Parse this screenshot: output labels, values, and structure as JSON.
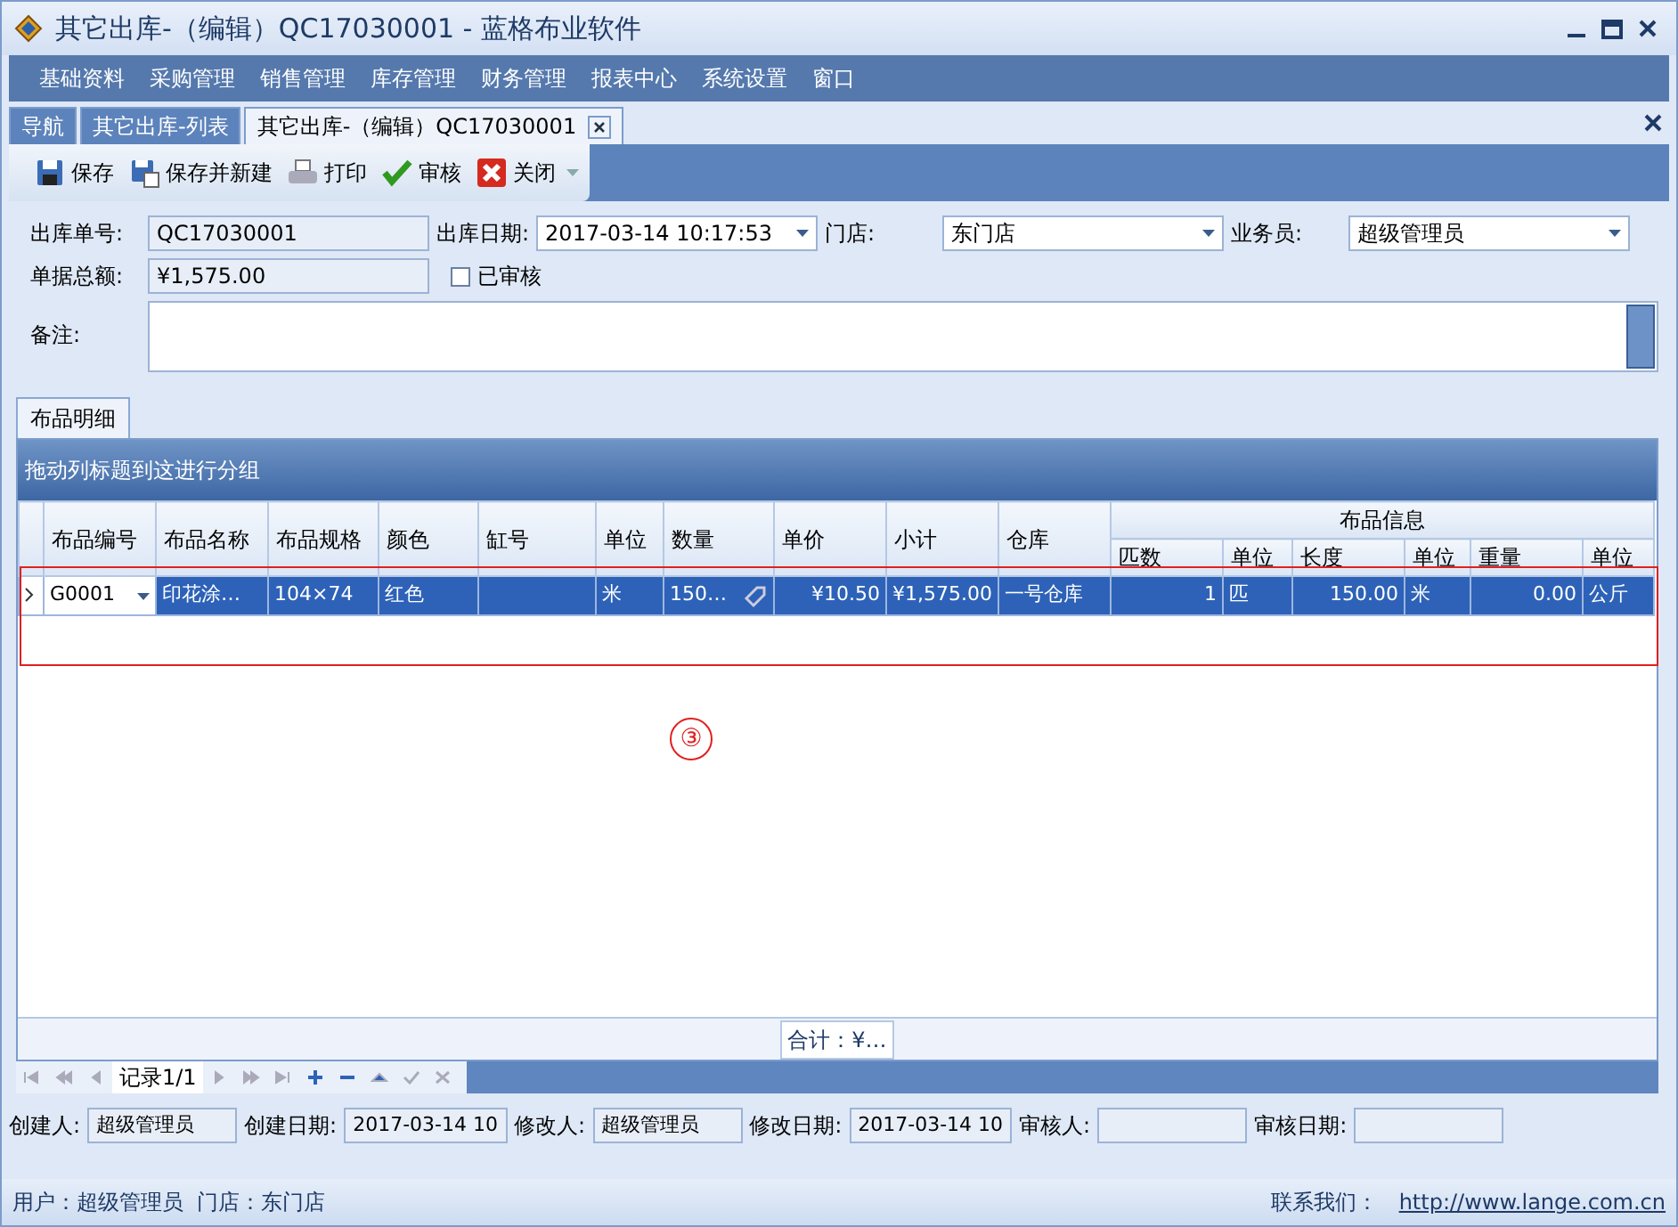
{
  "window": {
    "title": "其它出库-（编辑）QC17030001 - 蓝格布业软件"
  },
  "menu": {
    "items": [
      "基础资料",
      "采购管理",
      "销售管理",
      "库存管理",
      "财务管理",
      "报表中心",
      "系统设置",
      "窗口"
    ]
  },
  "tabs": [
    {
      "label": "导航",
      "selected": false,
      "closable": false
    },
    {
      "label": "其它出库-列表",
      "selected": false,
      "closable": false
    },
    {
      "label": "其它出库-（编辑）QC17030001",
      "selected": true,
      "closable": true
    }
  ],
  "toolbar": {
    "buttons": [
      {
        "label": "保存",
        "kind": "save"
      },
      {
        "label": "保存并新建",
        "kind": "save-new"
      },
      {
        "label": "打印",
        "kind": "print"
      },
      {
        "label": "审核",
        "kind": "approve"
      },
      {
        "label": "关闭",
        "kind": "close"
      }
    ]
  },
  "form": {
    "order_no": {
      "label": "出库单号:",
      "value": "QC17030001"
    },
    "date": {
      "label": "出库日期:",
      "value": "2017-03-14 10:17:53"
    },
    "store": {
      "label": "门店:",
      "value": "东门店"
    },
    "salesman": {
      "label": "业务员:",
      "value": "超级管理员"
    },
    "total": {
      "label": "单据总额:",
      "value": "¥1,575.00"
    },
    "audited": {
      "label": "已审核",
      "checked": false
    },
    "remark": {
      "label": "备注:"
    }
  },
  "detail_tabs": [
    {
      "label": "布品明细",
      "selected": true
    }
  ],
  "grid": {
    "group_hint": "拖动列标题到这进行分组",
    "columns": [
      "布品编号",
      "布品名称",
      "布品规格",
      "颜色",
      "缸号",
      "单位",
      "数量",
      "单价",
      "小计",
      "仓库"
    ],
    "band": {
      "label": "布品信息",
      "columns": [
        "匹数",
        "单位",
        "长度",
        "单位",
        "重量",
        "单位"
      ]
    },
    "rows": [
      {
        "selected": true,
        "cells": [
          "G0001",
          "印花涂…",
          "104×74",
          "红色",
          "",
          "米",
          "150…",
          "¥10.50",
          "¥1,575.00",
          "一号仓库",
          "1",
          "匹",
          "150.00",
          "米",
          "0.00",
          "公斤"
        ]
      }
    ],
    "summary": "合计：¥…",
    "navigator": "记录1/1"
  },
  "annotation": {
    "label": "③"
  },
  "audit": [
    {
      "label": "创建人:",
      "value": "超级管理员"
    },
    {
      "label": "创建日期:",
      "value": "2017-03-14 10"
    },
    {
      "label": "修改人:",
      "value": "超级管理员"
    },
    {
      "label": "修改日期:",
      "value": "2017-03-14 10"
    },
    {
      "label": "审核人:"
    },
    {
      "label": "审核日期:"
    }
  ],
  "status_bar": {
    "user": "用户：超级管理员  门店：东门店",
    "contact_label": "联系我们：",
    "link": "http://www.lange.com.cn"
  }
}
